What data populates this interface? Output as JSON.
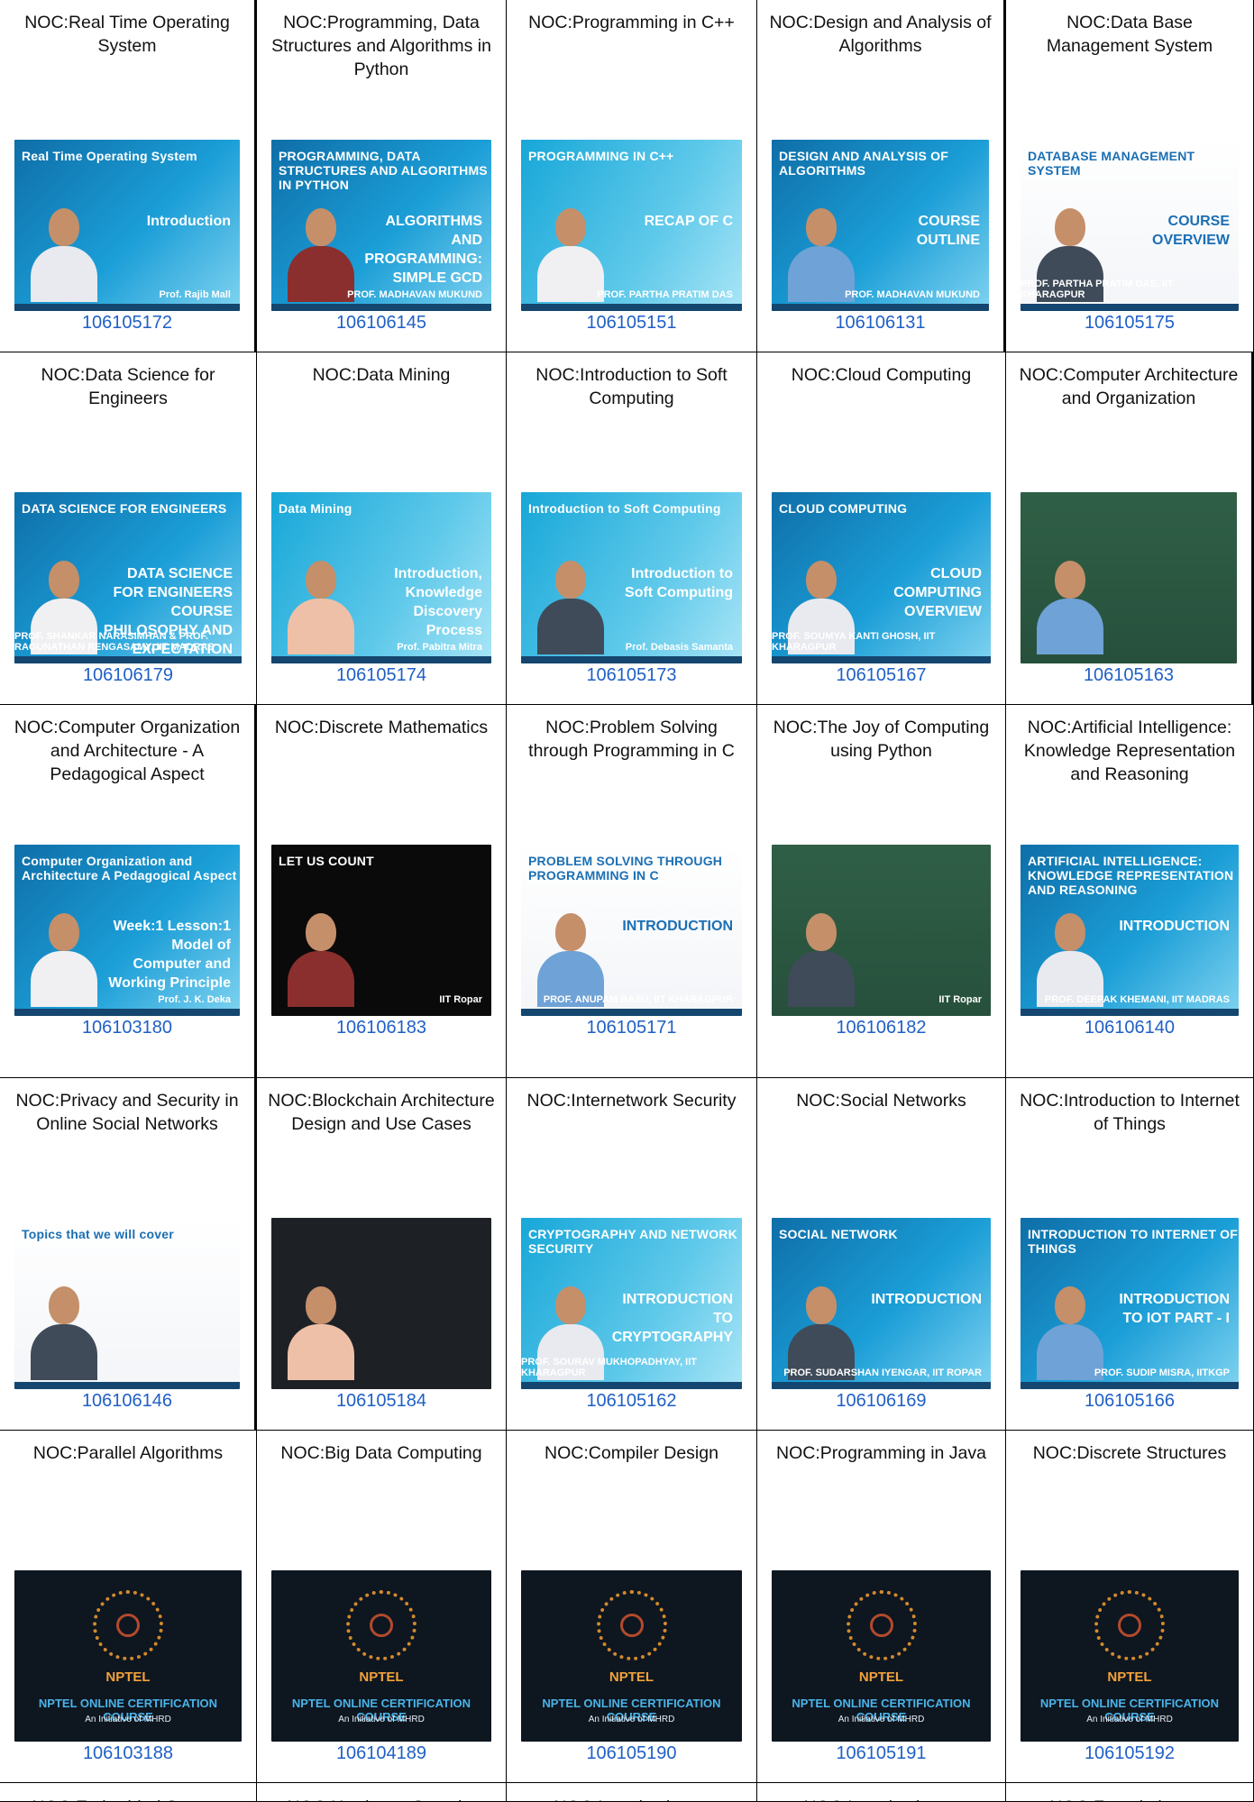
{
  "grid": {
    "rows": [
      [
        {
          "title": "NOC:Real Time Operating System",
          "code": "106105172",
          "thumb": {
            "theme": "blue",
            "name": "Real Time Operating System",
            "sub": "Introduction",
            "prof": "Prof. Rajib Mall",
            "person": "white"
          }
        },
        {
          "title": "NOC:Programming, Data Structures and Algorithms in Python",
          "code": "106106145",
          "thumb": {
            "theme": "blue",
            "name": "PROGRAMMING, DATA STRUCTURES AND ALGORITHMS IN PYTHON",
            "sub": "ALGORITHMS AND PROGRAMMING: SIMPLE GCD",
            "prof": "PROF. MADHAVAN MUKUND",
            "person": "red"
          }
        },
        {
          "title": "NOC:Programming in C++",
          "code": "106105151",
          "thumb": {
            "theme": "cyan",
            "name": "PROGRAMMING IN C++",
            "sub": "RECAP OF C",
            "prof": "PROF. PARTHA PRATIM DAS",
            "person": "light"
          }
        },
        {
          "title": "NOC:Design and Analysis of Algorithms",
          "code": "106106131",
          "thumb": {
            "theme": "blue",
            "name": "DESIGN AND ANALYSIS OF ALGORITHMS",
            "sub": "COURSE OUTLINE",
            "prof": "PROF. MADHAVAN MUKUND",
            "person": "blue"
          }
        },
        {
          "title": "NOC:Data Base Management System",
          "code": "106105175",
          "thumb": {
            "theme": "white",
            "name": "DATABASE MANAGEMENT SYSTEM",
            "sub": "COURSE OVERVIEW",
            "prof": "PROF. PARTHA PRATIM DAS, IIT KHARAGPUR",
            "person": "dark"
          }
        }
      ],
      [
        {
          "title": "NOC:Data Science for Engineers",
          "code": "106106179",
          "thumb": {
            "theme": "blue",
            "name": "DATA SCIENCE FOR ENGINEERS",
            "sub": "DATA SCIENCE FOR ENGINEERS COURSE PHILOSOPHY AND EXPECTATION",
            "prof": "PROF. SHANKAR NARASIMHAN & PROF. RAGUNATHAN RENGASAMY, IIT MADRAS",
            "person": "light"
          }
        },
        {
          "title": "NOC:Data Mining",
          "code": "106105174",
          "thumb": {
            "theme": "cyan",
            "name": "Data Mining",
            "sub": "Introduction, Knowledge Discovery Process",
            "prof": "Prof. Pabitra Mitra",
            "person": "pink"
          }
        },
        {
          "title": "NOC:Introduction to Soft Computing",
          "code": "106105173",
          "thumb": {
            "theme": "cyan",
            "name": "Introduction to Soft Computing",
            "sub": "Introduction to Soft Computing",
            "prof": "Prof. Debasis Samanta",
            "person": "dark"
          }
        },
        {
          "title": "NOC:Cloud Computing",
          "code": "106105167",
          "thumb": {
            "theme": "blue",
            "name": "CLOUD COMPUTING",
            "sub": "CLOUD COMPUTING OVERVIEW",
            "prof": "PROF. SOUMYA KANTI GHOSH, IIT KHARAGPUR",
            "person": "white"
          }
        },
        {
          "title": "NOC:Computer Architecture and Organization",
          "code": "106105163",
          "thumb": {
            "theme": "board",
            "name": "",
            "sub": "",
            "prof": "",
            "person": "blue"
          }
        }
      ],
      [
        {
          "title": "NOC:Computer Organization and Architecture - A Pedagogical Aspect",
          "code": "106103180",
          "thumb": {
            "theme": "blue",
            "name": "Computer Organization and Architecture A Pedagogical Aspect",
            "sub": "Week:1 Lesson:1 Model of Computer and Working Principle",
            "prof": "Prof. J. K. Deka",
            "person": "light"
          }
        },
        {
          "title": "NOC:Discrete Mathematics",
          "code": "106106183",
          "thumb": {
            "theme": "black",
            "name": "LET US COUNT",
            "sub": "",
            "prof": "IIT Ropar",
            "person": "red"
          }
        },
        {
          "title": "NOC:Problem Solving through Programming in C",
          "code": "106105171",
          "thumb": {
            "theme": "white",
            "name": "PROBLEM SOLVING THROUGH PROGRAMMING IN C",
            "sub": "INTRODUCTION",
            "prof": "PROF. ANUPAM BASU, IIT KHARAGPUR",
            "person": "blue"
          }
        },
        {
          "title": "NOC:The Joy of Computing using Python",
          "code": "106106182",
          "thumb": {
            "theme": "board",
            "name": "",
            "sub": "",
            "prof": "IIT Ropar",
            "person": "dark"
          }
        },
        {
          "title": "NOC:Artificial Intelligence: Knowledge Representation and Reasoning",
          "code": "106106140",
          "thumb": {
            "theme": "blue",
            "name": "ARTIFICIAL INTELLIGENCE: KNOWLEDGE REPRESENTATION AND REASONING",
            "sub": "INTRODUCTION",
            "prof": "PROF. DEEPAK KHEMANI, IIT MADRAS",
            "person": "white"
          }
        }
      ],
      [
        {
          "title": "NOC:Privacy and Security in Online Social Networks",
          "code": "106106146",
          "thumb": {
            "theme": "white",
            "name": "Topics that we will cover",
            "sub": "",
            "prof": "",
            "person": "dark"
          }
        },
        {
          "title": "NOC:Blockchain Architecture Design and Use Cases",
          "code": "106105184",
          "thumb": {
            "theme": "dark",
            "name": "",
            "sub": "",
            "prof": "",
            "person": "pink"
          }
        },
        {
          "title": "NOC:Internetwork Security",
          "code": "106105162",
          "thumb": {
            "theme": "cyan",
            "name": "CRYPTOGRAPHY AND NETWORK SECURITY",
            "sub": "INTRODUCTION TO CRYPTOGRAPHY",
            "prof": "PROF. SOURAV MUKHOPADHYAY, IIT KHARAGPUR",
            "person": "white"
          }
        },
        {
          "title": "NOC:Social Networks",
          "code": "106106169",
          "thumb": {
            "theme": "blue",
            "name": "SOCIAL NETWORK",
            "sub": "INTRODUCTION",
            "prof": "PROF. SUDARSHAN IYENGAR, IIT ROPAR",
            "person": "dark"
          }
        },
        {
          "title": "NOC:Introduction to Internet of Things",
          "code": "106105166",
          "thumb": {
            "theme": "blue",
            "name": "INTRODUCTION TO INTERNET OF THINGS",
            "sub": "INTRODUCTION TO IOT PART - I",
            "prof": "PROF. SUDIP MISRA, IITKGP",
            "person": "blue"
          }
        }
      ],
      [
        {
          "title": "NOC:Parallel Algorithms",
          "code": "106103188",
          "thumb": {
            "theme": "nptel",
            "name": "NPTEL",
            "sub": "NPTEL ONLINE CERTIFICATION COURSE",
            "prof": "An Initiative of MHRD",
            "person": ""
          }
        },
        {
          "title": "NOC:Big Data Computing",
          "code": "106104189",
          "thumb": {
            "theme": "nptel",
            "name": "NPTEL",
            "sub": "NPTEL ONLINE CERTIFICATION COURSE",
            "prof": "An Initiative of MHRD",
            "person": ""
          }
        },
        {
          "title": "NOC:Compiler Design",
          "code": "106105190",
          "thumb": {
            "theme": "nptel",
            "name": "NPTEL",
            "sub": "NPTEL ONLINE CERTIFICATION COURSE",
            "prof": "An Initiative of MHRD",
            "person": ""
          }
        },
        {
          "title": "NOC:Programming in Java",
          "code": "106105191",
          "thumb": {
            "theme": "nptel",
            "name": "NPTEL",
            "sub": "NPTEL ONLINE CERTIFICATION COURSE",
            "prof": "An Initiative of MHRD",
            "person": ""
          }
        },
        {
          "title": "NOC:Discrete Structures",
          "code": "106105192",
          "thumb": {
            "theme": "nptel",
            "name": "NPTEL",
            "sub": "NPTEL ONLINE CERTIFICATION COURSE",
            "prof": "An Initiative of MHRD",
            "person": ""
          }
        }
      ],
      [
        {
          "title": "NOC:Embedded System",
          "code": "",
          "thumb": null
        },
        {
          "title": "NOC:Hardware Security",
          "code": "",
          "thumb": null
        },
        {
          "title": "NOC:Introduction to",
          "code": "",
          "thumb": null
        },
        {
          "title": "NOC:Introduction to",
          "code": "",
          "thumb": null
        },
        {
          "title": "NOC:Foundations to",
          "code": "",
          "thumb": null
        }
      ]
    ]
  },
  "colors": {
    "link": "#1f5fc6",
    "border": "#000000",
    "text": "#111111"
  }
}
